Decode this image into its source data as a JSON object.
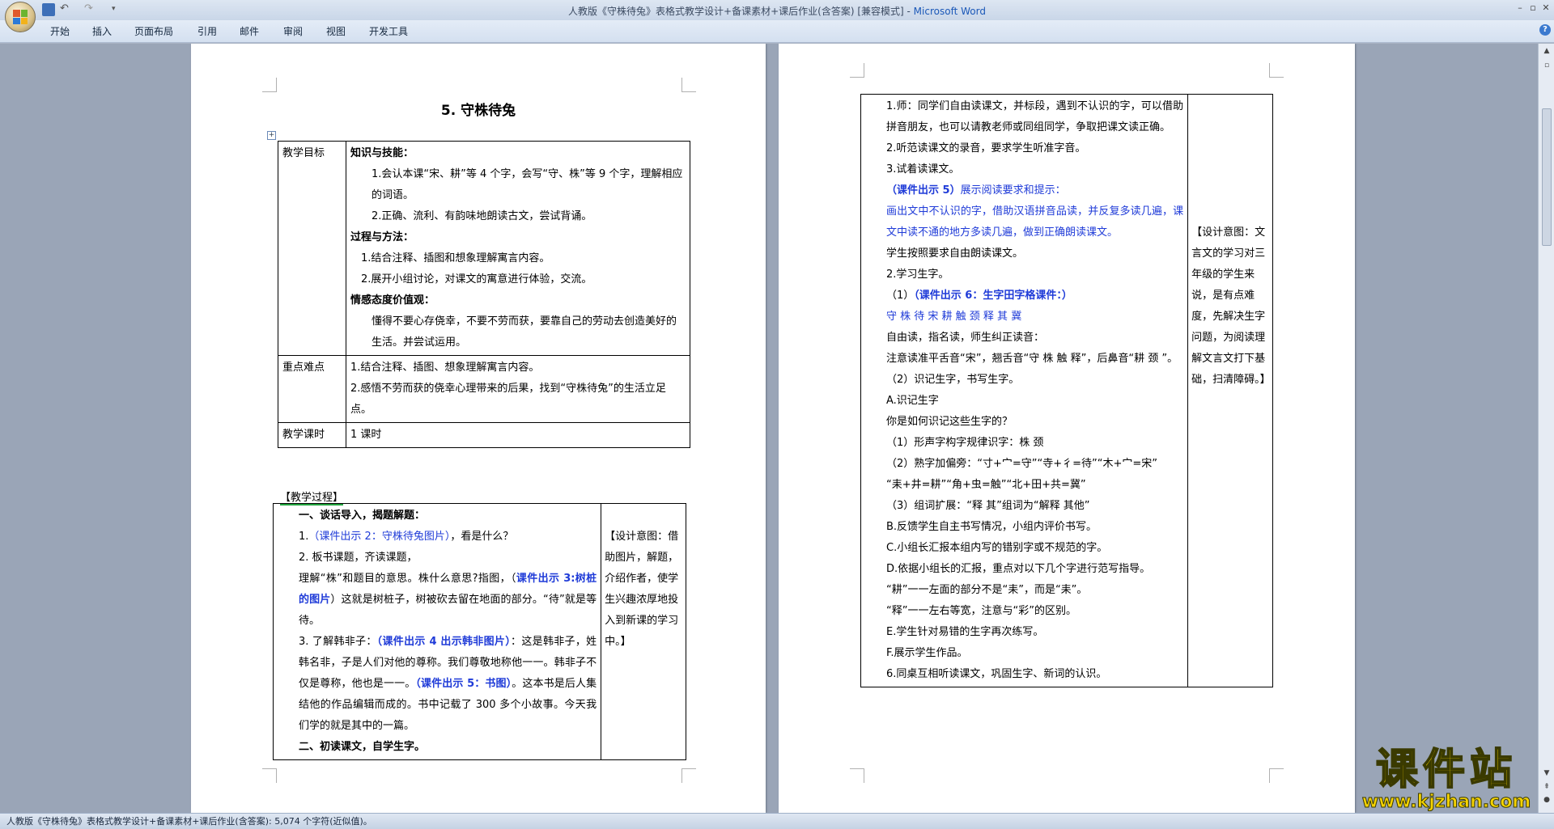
{
  "window": {
    "title": "人教版《守株待兔》表格式教学设计+备课素材+课后作业(含答案) [兼容模式]",
    "app_name": "Microsoft Word"
  },
  "ribbon_tabs": [
    "开始",
    "插入",
    "页面布局",
    "引用",
    "邮件",
    "审阅",
    "视图",
    "开发工具"
  ],
  "page1": {
    "title": "5. 守株待兔",
    "objectives_table": {
      "row1_label": "教学目标",
      "row1_lines": [
        {
          "text": "知识与技能：",
          "style": "bold"
        },
        {
          "text": "1.会认本课“宋、耕”等 4 个字，会写“守、株”等 9 个字，理解相应的词语。",
          "style": "indent1"
        },
        {
          "text": "2.正确、流利、有韵味地朗读古文，尝试背诵。",
          "style": "indent1"
        },
        {
          "text": "过程与方法：",
          "style": "bold"
        },
        {
          "text": "1.结合注释、插图和想象理解寓言内容。",
          "style": "indent2"
        },
        {
          "text": "2.展开小组讨论，对课文的寓意进行体验，交流。",
          "style": "indent2"
        },
        {
          "text": "情感态度价值观：",
          "style": "bold"
        },
        {
          "text": "懂得不要心存侥幸，不要不劳而获，要靠自己的劳动去创造美好的生活。并尝试运用。",
          "style": "indent1"
        }
      ],
      "row2_label": "重点难点",
      "row2_lines": [
        "1.结合注释、插图、想象理解寓言内容。",
        "2.感悟不劳而获的侥幸心理带来的后果，找到“守株待兔”的生活立足点。"
      ],
      "row3_label": "教学课时",
      "row3_value": "1 课时"
    },
    "process_label": "【教学过程】",
    "process_main": [
      {
        "parts": [
          {
            "t": "一、谈话导入，揭题解题：",
            "s": "bold"
          }
        ],
        "style": "indent1"
      },
      {
        "parts": [
          {
            "t": "1.",
            "s": ""
          },
          {
            "t": "（",
            "s": "blue"
          },
          {
            "t": "课件出示 2：守株待兔图片",
            "s": "blue"
          },
          {
            "t": "）",
            "s": "blue"
          },
          {
            "t": "，看是什么？",
            "s": ""
          }
        ],
        "style": "indent1"
      },
      {
        "parts": [
          {
            "t": "2. 板书课题，齐读课题，",
            "s": ""
          }
        ],
        "style": "indent1"
      },
      {
        "parts": [
          {
            "t": "理解“株”和题目的意思。株什么意思?指图，（",
            "s": ""
          },
          {
            "t": "课件出示 3:树桩的图片",
            "s": "blueb"
          },
          {
            "t": "）这就是树桩子，树被砍去留在地面的部分。“待”就是等待。",
            "s": ""
          }
        ],
        "style": "indent1"
      },
      {
        "parts": [
          {
            "t": "3. 了解韩非子：",
            "s": ""
          },
          {
            "t": "（课件出示 4 出示韩非图片）",
            "s": "blueb"
          },
          {
            "t": "：这是韩非子，姓韩名非，子是人们对他的尊称。我们尊敬地称他一一。韩非子不仅是尊称，他也是一一。",
            "s": ""
          },
          {
            "t": "（课件出示 5：书图）",
            "s": "blueb"
          },
          {
            "t": "。这本书是后人集结他的作品编辑而成的。书中记载了 300 多个小故事。今天我们学的就是其中的一篇。",
            "s": ""
          }
        ],
        "style": "indent1"
      },
      {
        "parts": [
          {
            "t": "二、初读课文，自学生字。",
            "s": "bold"
          }
        ],
        "style": "indent1"
      }
    ],
    "process_side": "【设计意图：借助图片，解题，介绍作者，使学生兴趣浓厚地投入到新课的学习中。】"
  },
  "page2": {
    "main_lines": [
      {
        "parts": [
          {
            "t": "1.师：同学们自由读课文，并标段，遇到不认识的字，可以借助拼音朋友，也可以请教老师或同组同学，争取把课文读正确。",
            "s": ""
          }
        ],
        "style": "indent1"
      },
      {
        "parts": [
          {
            "t": "2.听范读课文的录音，要求学生听准字音。",
            "s": ""
          }
        ],
        "style": "indent1"
      },
      {
        "parts": [
          {
            "t": "3.试着读课文。",
            "s": ""
          }
        ],
        "style": "indent1"
      },
      {
        "parts": [
          {
            "t": "（课件出示 5）",
            "s": "blueb"
          },
          {
            "t": "展示阅读要求和提示：",
            "s": "blue"
          }
        ],
        "style": "indent1"
      },
      {
        "parts": [
          {
            "t": "画出文中不认识的字，借助汉语拼音品读，并反复多读几遍，课文中读不通的地方多读几遍，做到正确朗读课文。",
            "s": "blue"
          }
        ],
        "style": "indent1"
      },
      {
        "parts": [
          {
            "t": "学生按照要求自由朗读课文。",
            "s": ""
          }
        ],
        "style": "indent1"
      },
      {
        "parts": [
          {
            "t": "2.学习生字。",
            "s": ""
          }
        ],
        "style": "indent1"
      },
      {
        "parts": [
          {
            "t": "（1）",
            "s": ""
          },
          {
            "t": "（课件出示 6：生字田字格课件：）",
            "s": "blueb"
          }
        ],
        "style": "indent1"
      },
      {
        "parts": [
          {
            "t": "守 株 待 宋 耕 触 颈 释 其 冀",
            "s": "blue"
          }
        ],
        "style": "indent1"
      },
      {
        "parts": [
          {
            "t": "自由读，指名读，师生纠正读音：",
            "s": ""
          }
        ],
        "style": "indent1"
      },
      {
        "parts": [
          {
            "t": "注意读准平舌音“宋”，翘舌音“守 株 触 释”，后鼻音“耕 颈 ”。",
            "s": ""
          }
        ],
        "style": "indent1"
      },
      {
        "parts": [
          {
            "t": "（2）识记生字，书写生字。",
            "s": ""
          }
        ],
        "style": "indent1"
      },
      {
        "parts": [
          {
            "t": "A.识记生字",
            "s": ""
          }
        ],
        "style": "indent1"
      },
      {
        "parts": [
          {
            "t": "你是如何识记这些生字的？",
            "s": ""
          }
        ],
        "style": "indent1"
      },
      {
        "parts": [
          {
            "t": "（1）形声字构字规律识字：株  颈",
            "s": ""
          }
        ],
        "style": "indent1"
      },
      {
        "parts": [
          {
            "t": "（2）熟字加偏旁：“寸+宀=守”“寺+彳=待”“木+宀=宋”",
            "s": ""
          }
        ],
        "style": "indent1"
      },
      {
        "parts": [
          {
            "t": "“耒+井=耕”“角+虫=触”“北+田+共=冀”",
            "s": ""
          }
        ],
        "style": "indent1"
      },
      {
        "parts": [
          {
            "t": "（3）组词扩展：“释 其”组词为“解释  其他”",
            "s": ""
          }
        ],
        "style": "indent1"
      },
      {
        "parts": [
          {
            "t": "B.反馈学生自主书写情况，小组内评价书写。",
            "s": ""
          }
        ],
        "style": "indent1"
      },
      {
        "parts": [
          {
            "t": "C.小组长汇报本组内写的错别字或不规范的字。",
            "s": ""
          }
        ],
        "style": "indent1"
      },
      {
        "parts": [
          {
            "t": "D.依据小组长的汇报，重点对以下几个字进行范写指导。",
            "s": ""
          }
        ],
        "style": "indent1"
      },
      {
        "parts": [
          {
            "t": "“耕”一一左面的部分不是“耒”，而是“耒”。",
            "s": ""
          }
        ],
        "style": "indent1"
      },
      {
        "parts": [
          {
            "t": "“释”一一左右等宽，注意与“彩”的区别。",
            "s": ""
          }
        ],
        "style": "indent1"
      },
      {
        "parts": [
          {
            "t": "E.学生针对易错的生字再次练写。",
            "s": ""
          }
        ],
        "style": "indent1"
      },
      {
        "parts": [
          {
            "t": "F.展示学生作品。",
            "s": ""
          }
        ],
        "style": "indent1"
      },
      {
        "parts": [
          {
            "t": "6.同桌互相听读课文，巩固生字、新词的认识。",
            "s": ""
          }
        ],
        "style": "indent1"
      }
    ],
    "side": "【设计意图：文言文的学习对三年级的学生来说，是有点难度，先解决生字问题，为阅读理解文言文打下基础，扫清障碍。】"
  },
  "status_bar": "人教版《守株待兔》表格式教学设计+备课素材+课后作业(含答案): 5,074 个字符(近似值)。",
  "watermark": {
    "brand": "课件站",
    "url": "www.kjzhan.com"
  },
  "colors": {
    "link_blue": "#1f3bd8",
    "watermark_yellow": "#f5d300",
    "title_blue": "#1b58b8"
  }
}
